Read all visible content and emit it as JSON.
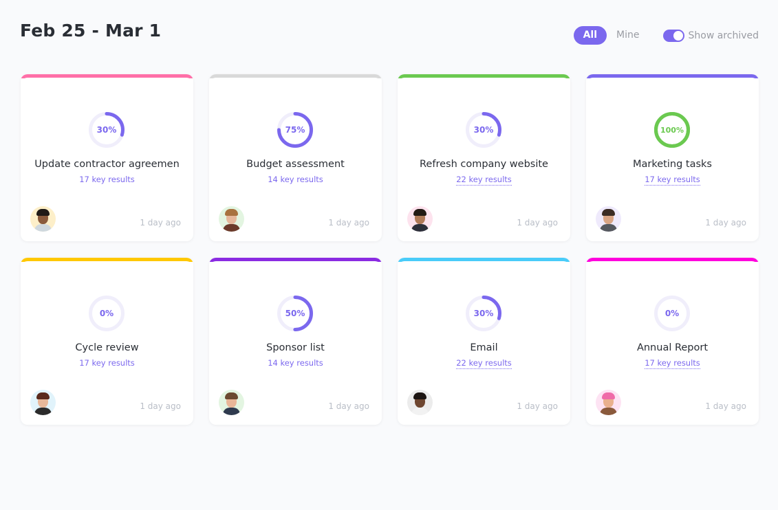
{
  "header": {
    "title": "Feb 25 - Mar 1",
    "filters": {
      "all_label": "All",
      "mine_label": "Mine",
      "active": "All",
      "show_archived_label": "Show archived",
      "show_archived_on": true
    }
  },
  "colors": {
    "accent": "#7b68ee",
    "complete": "#6bc950",
    "ring_track": "#f0eefb"
  },
  "cards": [
    {
      "name": "Update contractor agreemen",
      "progress": 30,
      "progress_label": "30%",
      "key_results": "17 key results",
      "key_results_link_style": "plain",
      "time": "1 day ago",
      "top_color": "#ff6fa8",
      "avatar": {
        "icon": "avatar-man-beard",
        "bg": "#fdefc9",
        "skin": "#8a5a3c",
        "hair": "#1f1a17",
        "shirt": "#cfd8de"
      }
    },
    {
      "name": "Budget assessment",
      "progress": 75,
      "progress_label": "75%",
      "key_results": "14 key results",
      "key_results_link_style": "plain",
      "time": "1 day ago",
      "top_color": "#d9d9d9",
      "avatar": {
        "icon": "avatar-woman-blonde",
        "bg": "#e3f5e1",
        "skin": "#e6b89c",
        "hair": "#a8723f",
        "shirt": "#6b3a2a"
      }
    },
    {
      "name": "Refresh company website",
      "progress": 30,
      "progress_label": "30%",
      "key_results": "22 key results",
      "key_results_link_style": "dotted",
      "time": "1 day ago",
      "top_color": "#6bc950",
      "avatar": {
        "icon": "avatar-man-afro",
        "bg": "#fde3ee",
        "skin": "#b07a58",
        "hair": "#231a14",
        "shirt": "#2d2f3a"
      }
    },
    {
      "name": "Marketing tasks",
      "progress": 100,
      "progress_label": "100%",
      "key_results": "17 key results",
      "key_results_link_style": "dotted",
      "time": "1 day ago",
      "top_color": "#7b68ee",
      "avatar": {
        "icon": "avatar-man-smiling",
        "bg": "#efeafc",
        "skin": "#d9a585",
        "hair": "#3b2c24",
        "shirt": "#55585f"
      }
    },
    {
      "name": "Cycle review",
      "progress": 0,
      "progress_label": "0%",
      "key_results": "17 key results",
      "key_results_link_style": "plain",
      "time": "1 day ago",
      "top_color": "#ffc800",
      "avatar": {
        "icon": "avatar-woman-brunette",
        "bg": "#e1f3fb",
        "skin": "#e8b89a",
        "hair": "#5a2a1c",
        "shirt": "#2b2b2b"
      }
    },
    {
      "name": "Sponsor list",
      "progress": 50,
      "progress_label": "50%",
      "key_results": "14 key results",
      "key_results_link_style": "plain",
      "time": "1 day ago",
      "top_color": "#8a2be2",
      "avatar": {
        "icon": "avatar-man-suit",
        "bg": "#e3f5e1",
        "skin": "#e9b698",
        "hair": "#6b4a30",
        "shirt": "#2f3a4e"
      }
    },
    {
      "name": "Email",
      "progress": 30,
      "progress_label": "30%",
      "key_results": "22 key results",
      "key_results_link_style": "dotted",
      "time": "1 day ago",
      "top_color": "#49ccf9",
      "avatar": {
        "icon": "avatar-woman-glasses",
        "bg": "#ececec",
        "skin": "#6e4630",
        "hair": "#1c1512",
        "shirt": "#f2f2f2"
      }
    },
    {
      "name": "Annual Report",
      "progress": 0,
      "progress_label": "0%",
      "key_results": "17 key results",
      "key_results_link_style": "dotted",
      "time": "1 day ago",
      "top_color": "#ff00dd",
      "avatar": {
        "icon": "avatar-woman-pink-hat",
        "bg": "#fde3f3",
        "skin": "#e9b08e",
        "hair": "#ef6aa8",
        "shirt": "#8a5a3c"
      }
    }
  ]
}
